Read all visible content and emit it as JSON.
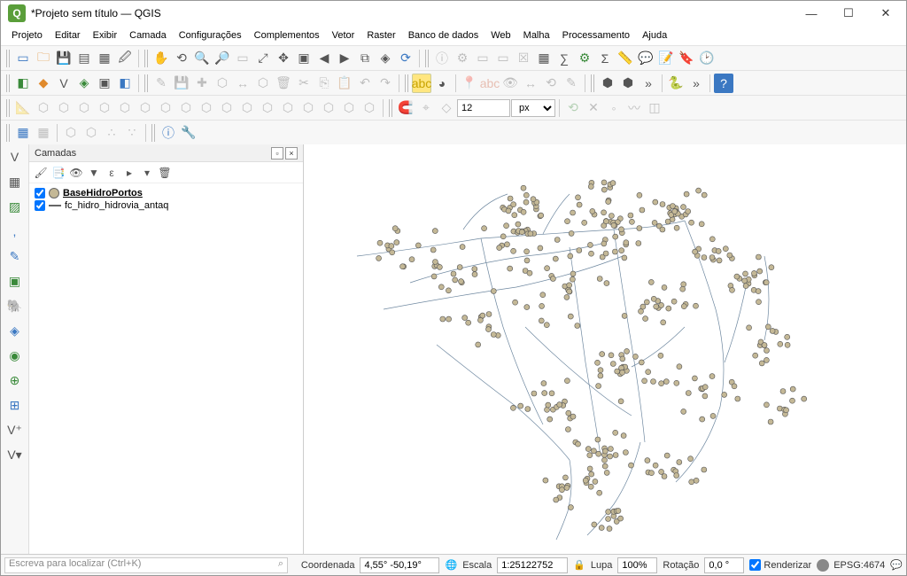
{
  "window": {
    "title": "*Projeto sem título — QGIS"
  },
  "menu": [
    "Projeto",
    "Editar",
    "Exibir",
    "Camada",
    "Configurações",
    "Complementos",
    "Vetor",
    "Raster",
    "Banco de dados",
    "Web",
    "Malha",
    "Processamento",
    "Ajuda"
  ],
  "snap": {
    "value": "12",
    "unit": "px"
  },
  "panel": {
    "title": "Camadas",
    "layers": [
      {
        "name": "BaseHidroPortos",
        "symbol": "point",
        "active": true,
        "checked": true
      },
      {
        "name": "fc_hidro_hidrovia_antaq",
        "symbol": "line",
        "active": false,
        "checked": true
      }
    ]
  },
  "status": {
    "search_placeholder": "Escreva para localizar (Ctrl+K)",
    "coord_label": "Coordenada",
    "coord_value": "4,55° -50,19°",
    "scale_label": "Escala",
    "scale_value": "1:25122752",
    "magnifier_label": "Lupa",
    "magnifier_value": "100%",
    "rotation_label": "Rotação",
    "rotation_value": "0,0 °",
    "render_label": "Renderizar",
    "crs": "EPSG:4674"
  }
}
